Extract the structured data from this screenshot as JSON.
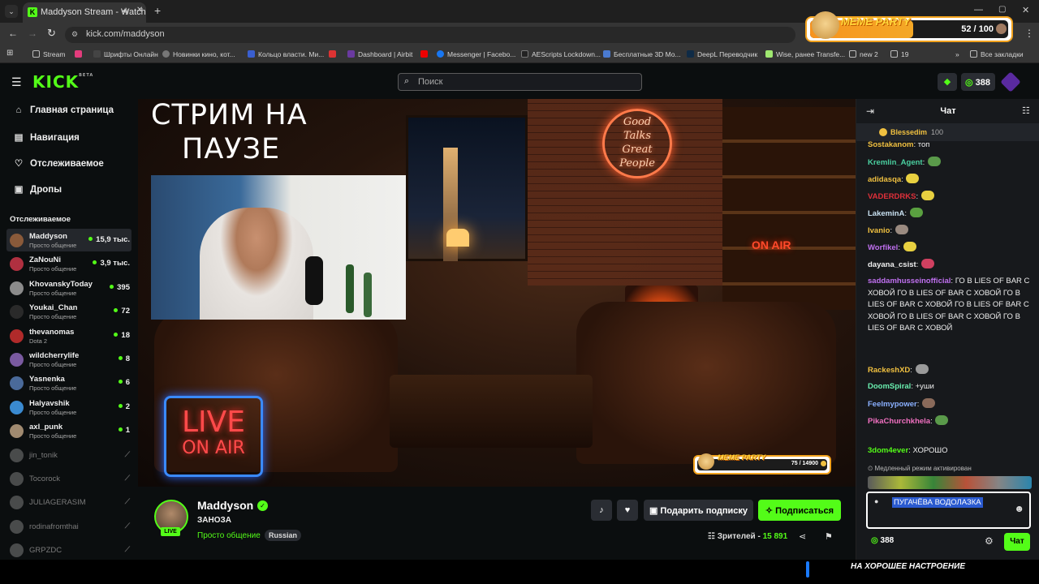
{
  "browser": {
    "tab_title": "Maddyson Stream - Watch",
    "url": "kick.com/maddyson",
    "bookmarks": [
      "Stream",
      "Шрифты Онлайн",
      "Новинки кино, кот...",
      "Кольцо власти. Ми...",
      "Dashboard | Airbit",
      "Messenger | Facebo...",
      "AEScripts Lockdown...",
      "Бесплатные 3D Mo...",
      "DeepL Переводчик",
      "Wise, ранее Transfe...",
      "new 2",
      "19",
      "Все закладки"
    ]
  },
  "meme_party": {
    "title": "MEME PARTY",
    "count": "52 / 100",
    "progress": 0.52
  },
  "header": {
    "logo": "KICK",
    "logo_badge": "BETA",
    "search_placeholder": "Поиск",
    "points": "388"
  },
  "sidebar": {
    "nav": [
      {
        "label": "Главная страница",
        "icon": "home-icon",
        "glyph": "⌂"
      },
      {
        "label": "Навигация",
        "icon": "browse-icon",
        "glyph": "▤"
      },
      {
        "label": "Отслеживаемое",
        "icon": "heart-icon",
        "glyph": "♡"
      },
      {
        "label": "Дропы",
        "icon": "gift-icon",
        "glyph": "▣"
      }
    ],
    "section_title": "Отслеживаемое",
    "channels": [
      {
        "name": "Maddyson",
        "category": "Просто общение",
        "viewers": "15,9 тыс.",
        "color": "#8a5a3a",
        "online": true
      },
      {
        "name": "ZaNouNi",
        "category": "Просто общение",
        "viewers": "3,9 тыс.",
        "color": "#b03040",
        "online": true
      },
      {
        "name": "KhovanskyToday",
        "category": "Просто общение",
        "viewers": "395",
        "color": "#8b8b8b",
        "online": true
      },
      {
        "name": "Youkai_Chan",
        "category": "Просто общение",
        "viewers": "72",
        "color": "#2a2a2a",
        "online": true
      },
      {
        "name": "thevanomas",
        "category": "Dota 2",
        "viewers": "18",
        "color": "#b02a2a",
        "online": true
      },
      {
        "name": "wildcherrylife",
        "category": "Просто общение",
        "viewers": "8",
        "color": "#7a5aa0",
        "online": true
      },
      {
        "name": "Yasnenka",
        "category": "Просто общение",
        "viewers": "6",
        "color": "#4a6a9a",
        "online": true
      },
      {
        "name": "Halyavshik",
        "category": "Просто общение",
        "viewers": "2",
        "color": "#3a8ad0",
        "online": true
      },
      {
        "name": "axl_punk",
        "category": "Просто общение",
        "viewers": "1",
        "color": "#a08a70",
        "online": true
      },
      {
        "name": "jin_tonik",
        "category": "",
        "viewers": "⟋",
        "color": "#888",
        "online": false
      },
      {
        "name": "Tocorock",
        "category": "",
        "viewers": "⟋",
        "color": "#888",
        "online": false
      },
      {
        "name": "JULIAGERASIM",
        "category": "",
        "viewers": "⟋",
        "color": "#888",
        "online": false
      },
      {
        "name": "rodinafromthai",
        "category": "",
        "viewers": "⟋",
        "color": "#888",
        "online": false
      },
      {
        "name": "GRPZDC",
        "category": "",
        "viewers": "⟋",
        "color": "#888",
        "online": false
      }
    ]
  },
  "video": {
    "overlay_text_line1": "СТРИМ НА",
    "overlay_text_line2": "ПАУЗЕ",
    "neon_sign": [
      "Good",
      "Talks",
      "Great",
      "People"
    ],
    "on_air_sign": "ON AIR",
    "live_sign_line1": "LIVE",
    "live_sign_line2": "ON AIR",
    "widget_title": "MEME PARTY",
    "widget_count": "75 / 14900"
  },
  "stream": {
    "streamer": "Maddyson",
    "title": "ЗАНОЗА",
    "category": "Просто общение",
    "tag": "Russian",
    "live_badge": "LIVE",
    "gift_sub_label": "Подарить подписку",
    "subscribe_label": "Подписаться",
    "viewers_label": "Зрителей -",
    "viewers": "15 891"
  },
  "chat": {
    "title": "Чат",
    "pinned_user": "Blessedim",
    "pinned_amount": "100",
    "messages": [
      {
        "user": "Sostakanom",
        "color": "#f0c040",
        "text": "топ"
      },
      {
        "user": "Kremlin_Agent",
        "color": "#4ad0a0",
        "text": ""
      },
      {
        "user": "adidasqa",
        "color": "#f0c040",
        "text": ""
      },
      {
        "user": "VADERDRKS",
        "color": "#e0303a",
        "text": ""
      },
      {
        "user": "LakeminA",
        "color": "#c8e0f0",
        "text": ""
      },
      {
        "user": "Ivanio",
        "color": "#f0c040",
        "text": ""
      },
      {
        "user": "Worfikel",
        "color": "#c070f0",
        "text": ""
      },
      {
        "user": "dayana_csist",
        "color": "#f0f0f0",
        "text": ""
      },
      {
        "user": "saddamhusseinofficial",
        "color": "#c070f0",
        "text": "ГО В LIES OF BAR С ХОВОЙ ГО В LIES OF BAR С ХОВОЙ ГО В LIES OF BAR С ХОВОЙ ГО В LIES OF BAR С ХОВОЙ ГО В LIES OF BAR С ХОВОЙ ГО В LIES OF BAR С ХОВОЙ"
      },
      {
        "user": "RackeshXD",
        "color": "#f0c040",
        "text": ""
      },
      {
        "user": "DoomSpiral",
        "color": "#6af0b0",
        "text": "+уши"
      },
      {
        "user": "Feelmypower",
        "color": "#8ab0ff",
        "text": ""
      },
      {
        "user": "PikaChurchkhela",
        "color": "#f070c0",
        "text": ""
      },
      {
        "user": "3dom4ever",
        "color": "#53fc18",
        "text": "ХОРОШО"
      }
    ],
    "slow_mode_notice": "Медленный режим активирован",
    "input_text": "ПУГАЧЁВА ВОДОЛАЗКА",
    "points": "388",
    "send_label": "Чат"
  },
  "bottom_caption": "НА ХОРОШЕЕ НАСТРОЕНИЕ",
  "colors": {
    "accent": "#53fc18",
    "background": "#0b0e0f",
    "chat_bg": "#17191c"
  }
}
